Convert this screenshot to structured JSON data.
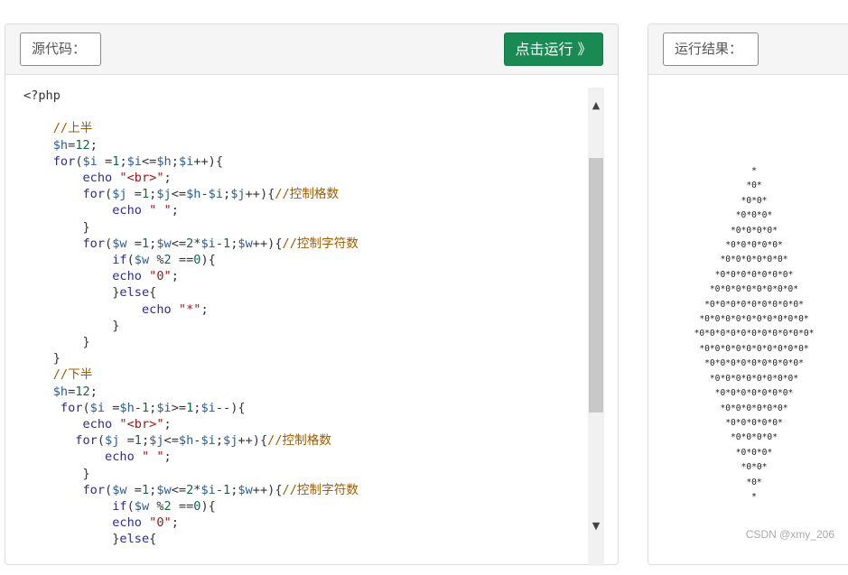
{
  "source_panel": {
    "label": "源代码：",
    "run_button": "点击运行 》"
  },
  "result_panel": {
    "label": "运行结果："
  },
  "code_lines": [
    "<?php",
    "",
    "    //上半",
    "    $h=12;",
    "    for($i =1;$i<=$h;$i++){",
    "        echo \"<br>\";",
    "        for($j =1;$j<=$h-$i;$j++){//控制格数",
    "            echo \" \";",
    "        }",
    "        for($w =1;$w<=2*$i-1;$w++){//控制字符数",
    "            if($w %2 ==0){",
    "            echo \"0\";",
    "            }else{",
    "                echo \"*\";",
    "            }",
    "        }",
    "    }",
    "    //下半",
    "    $h=12;",
    "     for($i =$h-1;$i>=1;$i--){",
    "        echo \"<br>\";",
    "       for($j =1;$j<=$h-$i;$j++){//控制格数",
    "           echo \" \";",
    "        }",
    "        for($w =1;$w<=2*$i-1;$w++){//控制字符数",
    "            if($w %2 ==0){",
    "            echo \"0\";",
    "            }else{"
  ],
  "output_lines": [
    "*",
    "*0*",
    "*0*0*",
    "*0*0*0*",
    "*0*0*0*0*",
    "*0*0*0*0*0*",
    "*0*0*0*0*0*0*",
    "*0*0*0*0*0*0*0*",
    "*0*0*0*0*0*0*0*0*",
    "*0*0*0*0*0*0*0*0*0*",
    "*0*0*0*0*0*0*0*0*0*0*",
    "*0*0*0*0*0*0*0*0*0*0*0*",
    "*0*0*0*0*0*0*0*0*0*0*",
    "*0*0*0*0*0*0*0*0*0*",
    "*0*0*0*0*0*0*0*0*",
    "*0*0*0*0*0*0*0*",
    "*0*0*0*0*0*0*",
    "*0*0*0*0*0*",
    "*0*0*0*0*",
    "*0*0*0*",
    "*0*0*",
    "*0*",
    "*"
  ],
  "watermark": "CSDN @xmy_206",
  "colors": {
    "run_button": "#1a8a55",
    "comment": "#a05a00",
    "variable": "#2c5d8f",
    "string": "#a31515"
  }
}
